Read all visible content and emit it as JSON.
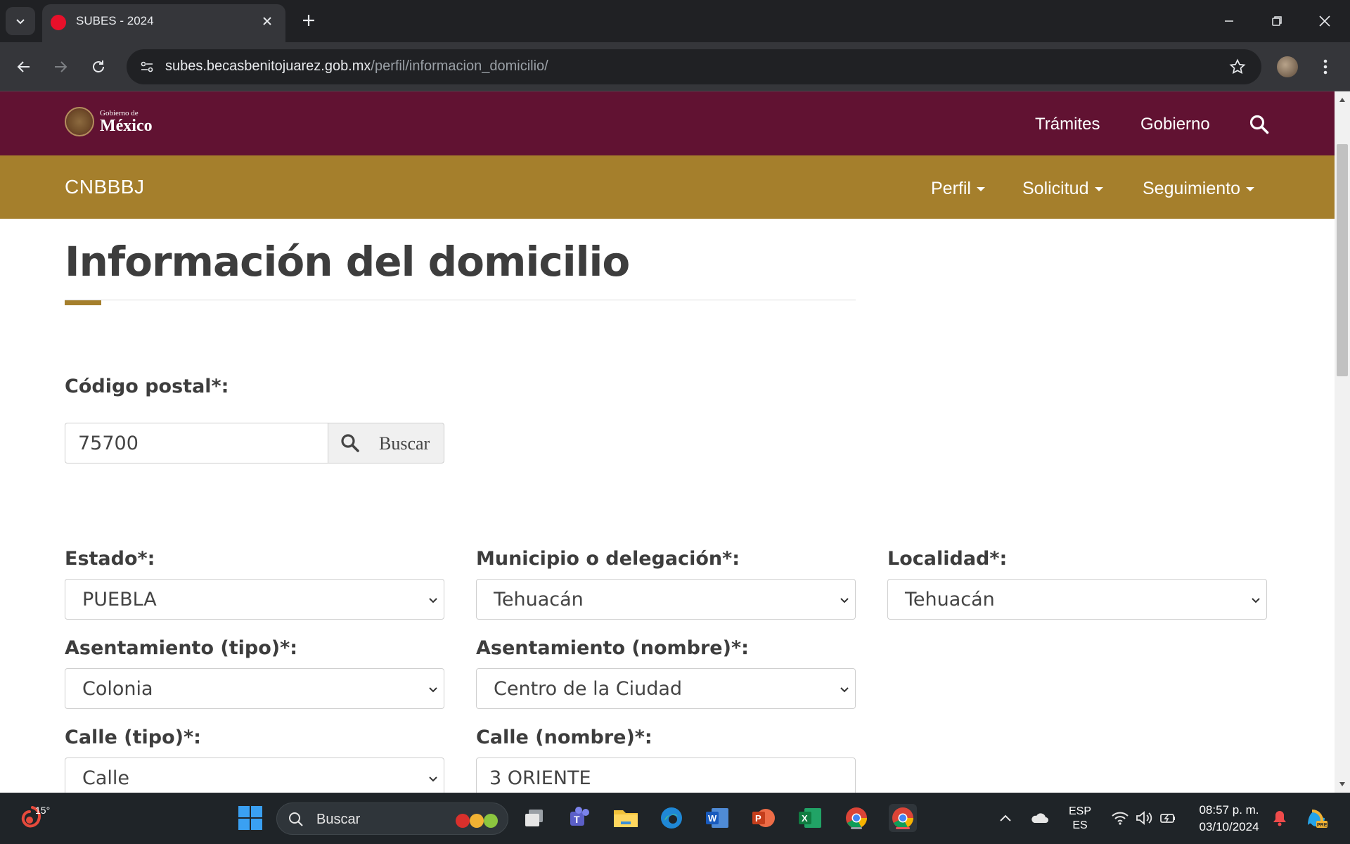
{
  "browser": {
    "tab_title": "SUBES - 2024",
    "url_host": "subes.becasbenitojuarez.gob.mx",
    "url_path": "/perfil/informacion_domicilio/"
  },
  "gov_header": {
    "logo_small": "Gobierno de",
    "logo_big": "México",
    "nav": [
      "Trámites",
      "Gobierno"
    ]
  },
  "sub_header": {
    "brand": "CNBBBJ",
    "nav": [
      "Perfil",
      "Solicitud",
      "Seguimiento"
    ]
  },
  "page": {
    "title": "Información del domicilio"
  },
  "form": {
    "codigo_postal": {
      "label": "Código postal*:",
      "value": "75700",
      "button_label": "Buscar"
    },
    "estado": {
      "label": "Estado*:",
      "value": "PUEBLA"
    },
    "municipio": {
      "label": "Municipio o delegación*:",
      "value": "Tehuacán"
    },
    "localidad": {
      "label": "Localidad*:",
      "value": "Tehuacán"
    },
    "asentamiento_tipo": {
      "label": "Asentamiento (tipo)*:",
      "value": "Colonia"
    },
    "asentamiento_nombre": {
      "label": "Asentamiento (nombre)*:",
      "value": "Centro de la Ciudad"
    },
    "calle_tipo": {
      "label": "Calle (tipo)*:",
      "value": "Calle"
    },
    "calle_nombre": {
      "label": "Calle (nombre)*:",
      "value": "3 ORIENTE"
    }
  },
  "taskbar": {
    "weather_temp": "15°",
    "search_placeholder": "Buscar",
    "lang_top": "ESP",
    "lang_bottom": "ES",
    "time": "08:57 p. m.",
    "date": "03/10/2024"
  },
  "colors": {
    "gov_primary": "#611232",
    "gov_gold": "#a57f2c"
  }
}
